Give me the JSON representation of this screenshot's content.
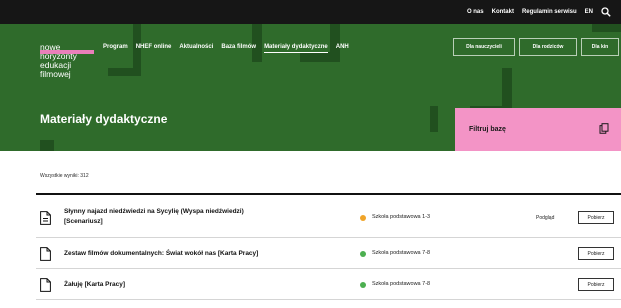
{
  "topbar": {
    "links": [
      "O nas",
      "Kontakt",
      "Regulamin serwisu",
      "EN"
    ],
    "search_icon": "search-icon"
  },
  "logo": {
    "lines": [
      "nowe",
      "horyzonty",
      "edukacji",
      "filmowej"
    ]
  },
  "nav": {
    "items": [
      "Program",
      "NHEF online",
      "Aktualności",
      "Baza filmów",
      "Materiały dydaktyczne",
      "ANH"
    ],
    "active_index": 4
  },
  "audience": {
    "buttons": [
      "Dla nauczycieli",
      "Dla rodziców",
      "Dla kin"
    ]
  },
  "page": {
    "title": "Materiały dydaktyczne",
    "filter_label": "Filtruj bazę",
    "results_text": "Wszystkie wyniki: 312"
  },
  "rows": [
    {
      "title_lines": [
        "Słynny najazd niedźwiedzi na Sycylię (Wyspa niedźwiedzi)",
        "[Scenariusz]"
      ],
      "level": "Szkoła podstawowa 1-3",
      "level_color": "#f0a429",
      "preview": "Podgląd",
      "download": "Pobierz"
    },
    {
      "title_lines": [
        "Zestaw filmów dokumentalnych: Świat wokół nas [Karta Pracy]"
      ],
      "level": "Szkoła podstawowa 7-8",
      "level_color": "#4caf50",
      "download": "Pobierz"
    },
    {
      "title_lines": [
        "Żałuję [Karta Pracy]"
      ],
      "level": "Szkoła podstawowa 7-8",
      "level_color": "#4caf50",
      "download": "Pobierz"
    }
  ],
  "colors": {
    "hero": "#2f6b2b",
    "hero_decor": "#21501f",
    "filter": "#f394c6",
    "accent_pink": "#ea7fba",
    "topbar": "#161616"
  }
}
